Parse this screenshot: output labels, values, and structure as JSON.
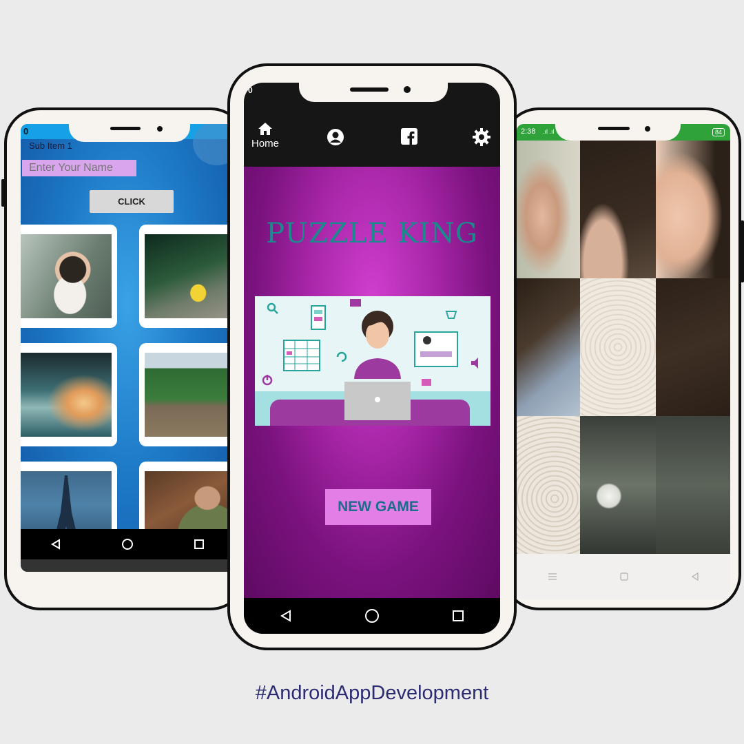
{
  "left_phone": {
    "status_time": "0",
    "subtitle": "Sub Item 1",
    "name_input": {
      "placeholder": "Enter Your Name",
      "value": ""
    },
    "click_button": "CLICK",
    "gallery": [
      "girl-with-dandelion",
      "minion-on-rock",
      "ocean-wave",
      "train-on-bridge",
      "eiffel-tower-birds",
      "man-with-camera"
    ]
  },
  "middle_phone": {
    "status_time": "0",
    "nav": {
      "home_label": "Home",
      "icons": [
        "home-icon",
        "profile-icon",
        "facebook-icon",
        "settings-icon"
      ]
    },
    "title": "PUZZLE KING",
    "new_game_button": "NEW GAME",
    "colors": {
      "background_center": "#d13fd0",
      "background_edge": "#5e0a62",
      "title": "#1a8a8c",
      "button_bg": "#e27ee6",
      "button_text": "#1a6e8c"
    }
  },
  "right_phone": {
    "status_time": "2:38",
    "battery": "84"
  },
  "footer": {
    "hashtag": "#AndroidAppDevelopment"
  }
}
